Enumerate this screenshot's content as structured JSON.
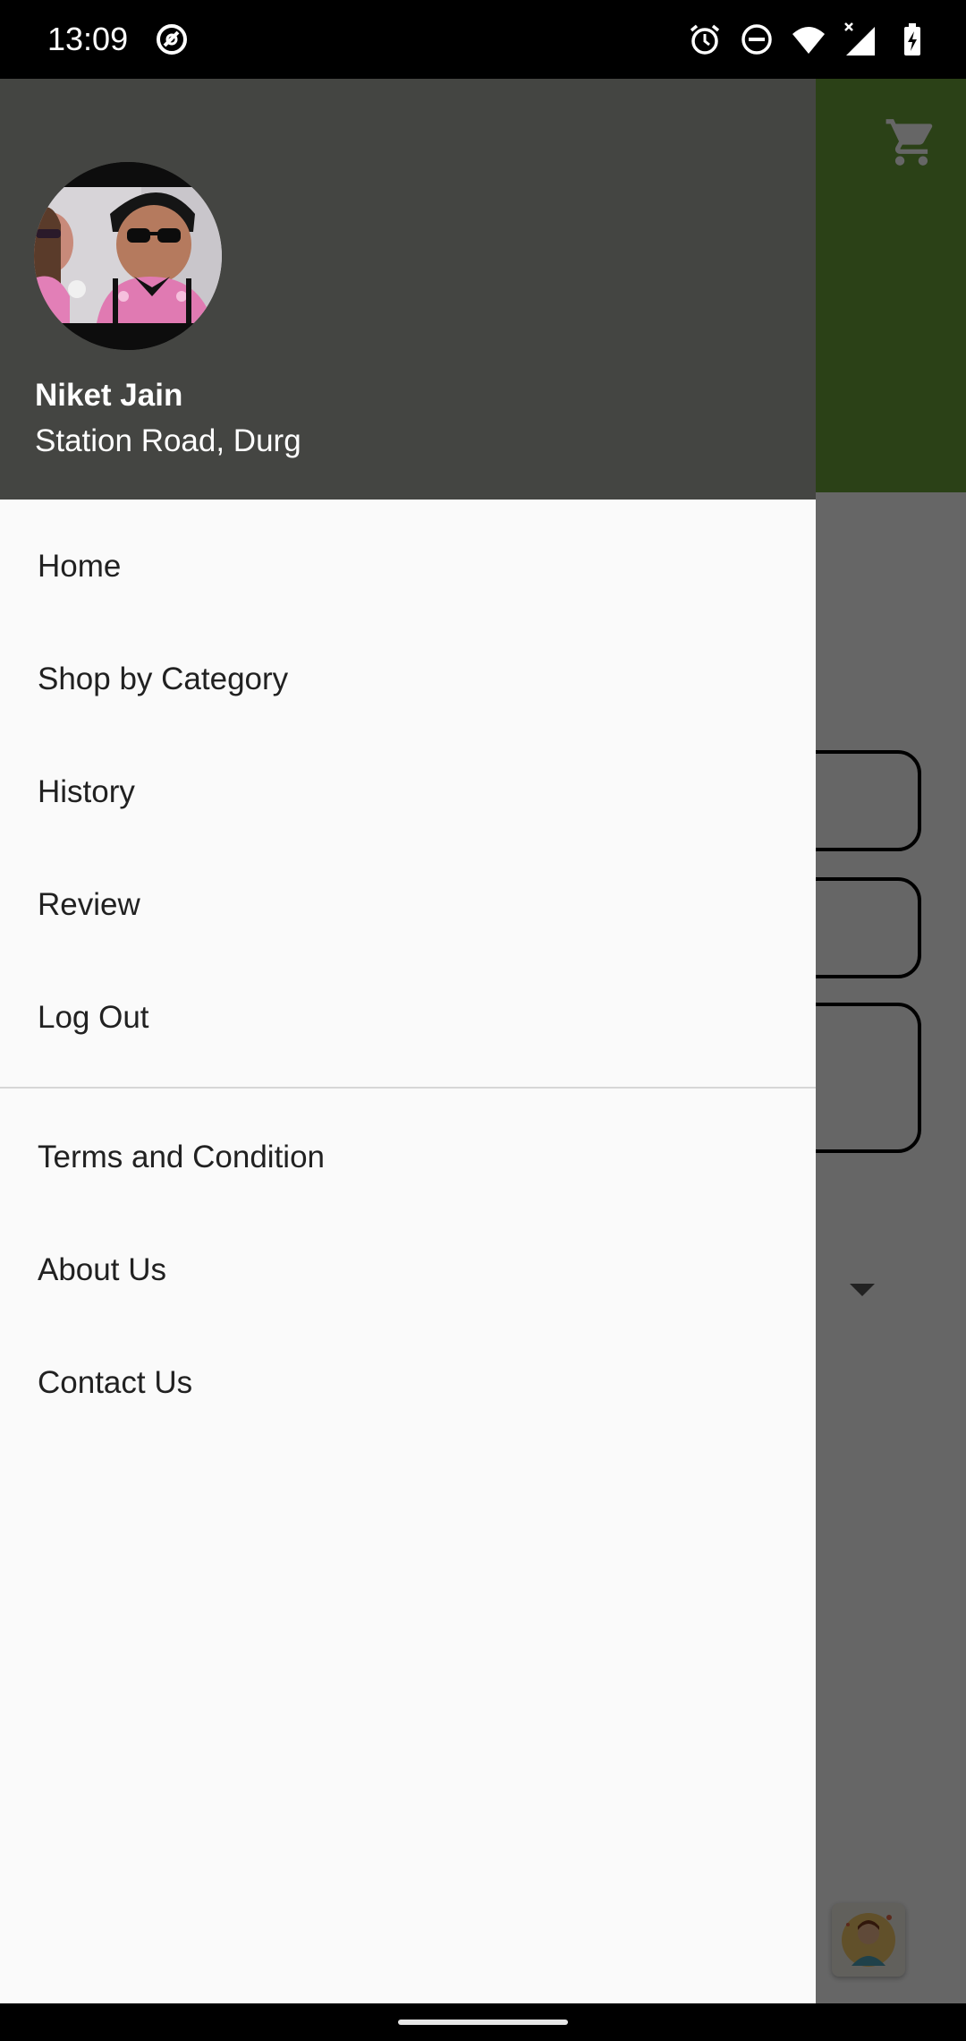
{
  "status_bar": {
    "time": "13:09",
    "icons": [
      "data-saver-icon",
      "alarm-icon",
      "do-not-disturb-icon",
      "wifi-icon",
      "no-signal-icon",
      "battery-charging-icon"
    ]
  },
  "app": {
    "toolbar_color": "#6ca23a",
    "cart_icon": "cart-icon"
  },
  "drawer": {
    "header": {
      "name": "Niket Jain",
      "location": "Station Road, Durg"
    },
    "menu_primary": [
      {
        "label": "Home"
      },
      {
        "label": "Shop by Category"
      },
      {
        "label": "History"
      },
      {
        "label": "Review"
      },
      {
        "label": "Log Out"
      }
    ],
    "menu_secondary": [
      {
        "label": "Terms and Condition"
      },
      {
        "label": "About Us"
      },
      {
        "label": "Contact Us"
      }
    ]
  }
}
